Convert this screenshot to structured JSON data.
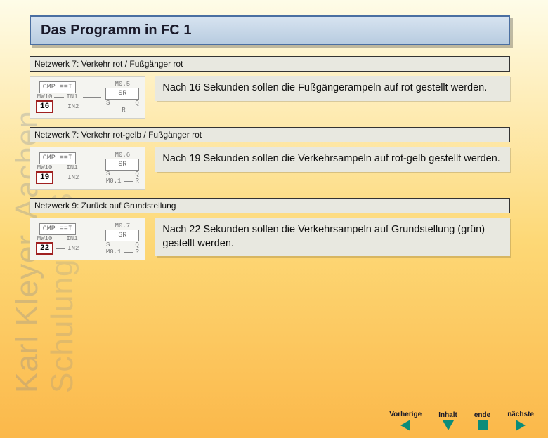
{
  "title": "Das Programm in FC 1",
  "watermark1": "Karl Kleyer, Aachen",
  "watermark2": "Schulungen SPS",
  "networks": [
    {
      "header": "Netzwerk 7: Verkehr rot / Fußgänger rot",
      "cmp": {
        "title": "CMP ==I",
        "in1_src": "MW10",
        "in1_lbl": "IN1",
        "in2_lbl": "IN2",
        "value": "16"
      },
      "sr": {
        "addr": "M0.5",
        "title": "SR",
        "s": "S",
        "r": "R",
        "q": "Q",
        "r_src": ""
      },
      "desc": "Nach 16 Sekunden sollen die Fußgängerampeln auf rot gestellt werden."
    },
    {
      "header": "Netzwerk 7: Verkehr rot-gelb / Fußgänger rot",
      "cmp": {
        "title": "CMP ==I",
        "in1_src": "MW10",
        "in1_lbl": "IN1",
        "in2_lbl": "IN2",
        "value": "19"
      },
      "sr": {
        "addr": "M0.6",
        "title": "SR",
        "s": "S",
        "r": "R",
        "q": "Q",
        "r_src": "M0.1"
      },
      "desc": "Nach 19 Sekunden sollen die Verkehrsampeln auf rot-gelb gestellt werden."
    },
    {
      "header": "Netzwerk 9: Zurück auf Grundstellung",
      "cmp": {
        "title": "CMP ==I",
        "in1_src": "MW10",
        "in1_lbl": "IN1",
        "in2_lbl": "IN2",
        "value": "22"
      },
      "sr": {
        "addr": "M0.7",
        "title": "SR",
        "s": "S",
        "r": "R",
        "q": "Q",
        "r_src": "M0.1"
      },
      "desc": "Nach 22 Sekunden sollen die Verkehrsampeln auf Grundstellung (grün) gestellt werden."
    }
  ],
  "footer": {
    "prev": "Vorherige",
    "toc": "Inhalt",
    "end": "ende",
    "next": "nächste"
  }
}
